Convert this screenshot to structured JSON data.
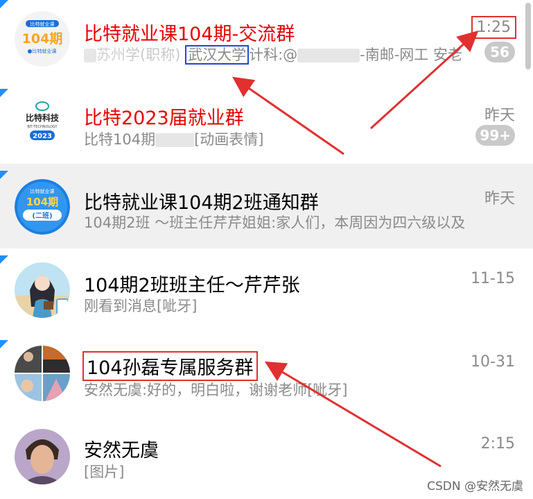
{
  "chats": [
    {
      "title": "比特就业课104期-交流群",
      "time": "1:25",
      "badge": "56",
      "preview_before": "苏州",
      "preview_mid1": "学(职称)",
      "preview_highlight": "武汉大学",
      "preview_after": "计科:@",
      "preview_tail": "-南邮-网工 安老",
      "avatar": {
        "text1": "比特就业课",
        "text2": "104期",
        "text3": "比特就业课"
      }
    },
    {
      "title": "比特2023届就业群",
      "time": "昨天",
      "badge": "99+",
      "preview_before": "比特104期",
      "preview_after": "[动画表情]",
      "avatar": {
        "text1": "比特科技",
        "text2": "BIT-TECHNOLOGY",
        "text3": "2023"
      }
    },
    {
      "title": "比特就业课104期2班通知群",
      "time": "昨天",
      "preview": "104期2班 ～班主任芹芹姐姐:家人们，本周因为四六级以及",
      "avatar": {
        "text1": "比特就业课",
        "text2": "104期",
        "text3": "(二班)"
      }
    },
    {
      "title": "104期2班班主任～芹芹张",
      "time": "11-15",
      "preview": "刚看到消息[呲牙]"
    },
    {
      "title": "104孙磊专属服务群",
      "time": "10-31",
      "preview": "安然无虞:好的，明白啦，谢谢老师[呲牙]"
    },
    {
      "title": "安然无虞",
      "time": "2:15",
      "preview": "[图片]"
    }
  ],
  "watermark": "CSDN @安然无虞",
  "colors": {
    "accent": "#1e90ff",
    "red_title": "#e60000",
    "annotation_red": "#e03030",
    "annotation_blue": "#2547c8"
  }
}
